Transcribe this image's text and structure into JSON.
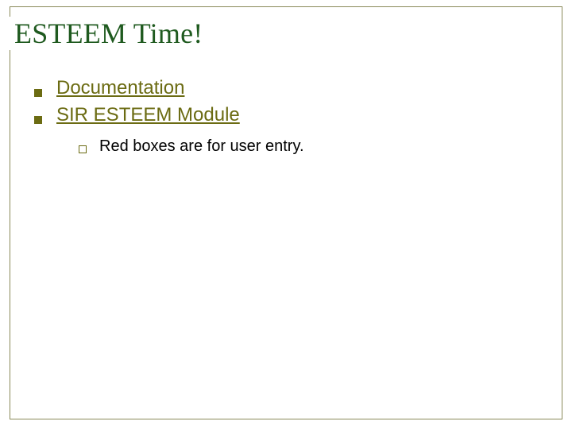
{
  "title": "ESTEEM Time!",
  "items": [
    {
      "label": "Documentation"
    },
    {
      "label": "SIR ESTEEM Module"
    }
  ],
  "subitems": [
    {
      "label": "Red boxes are for user entry."
    }
  ]
}
